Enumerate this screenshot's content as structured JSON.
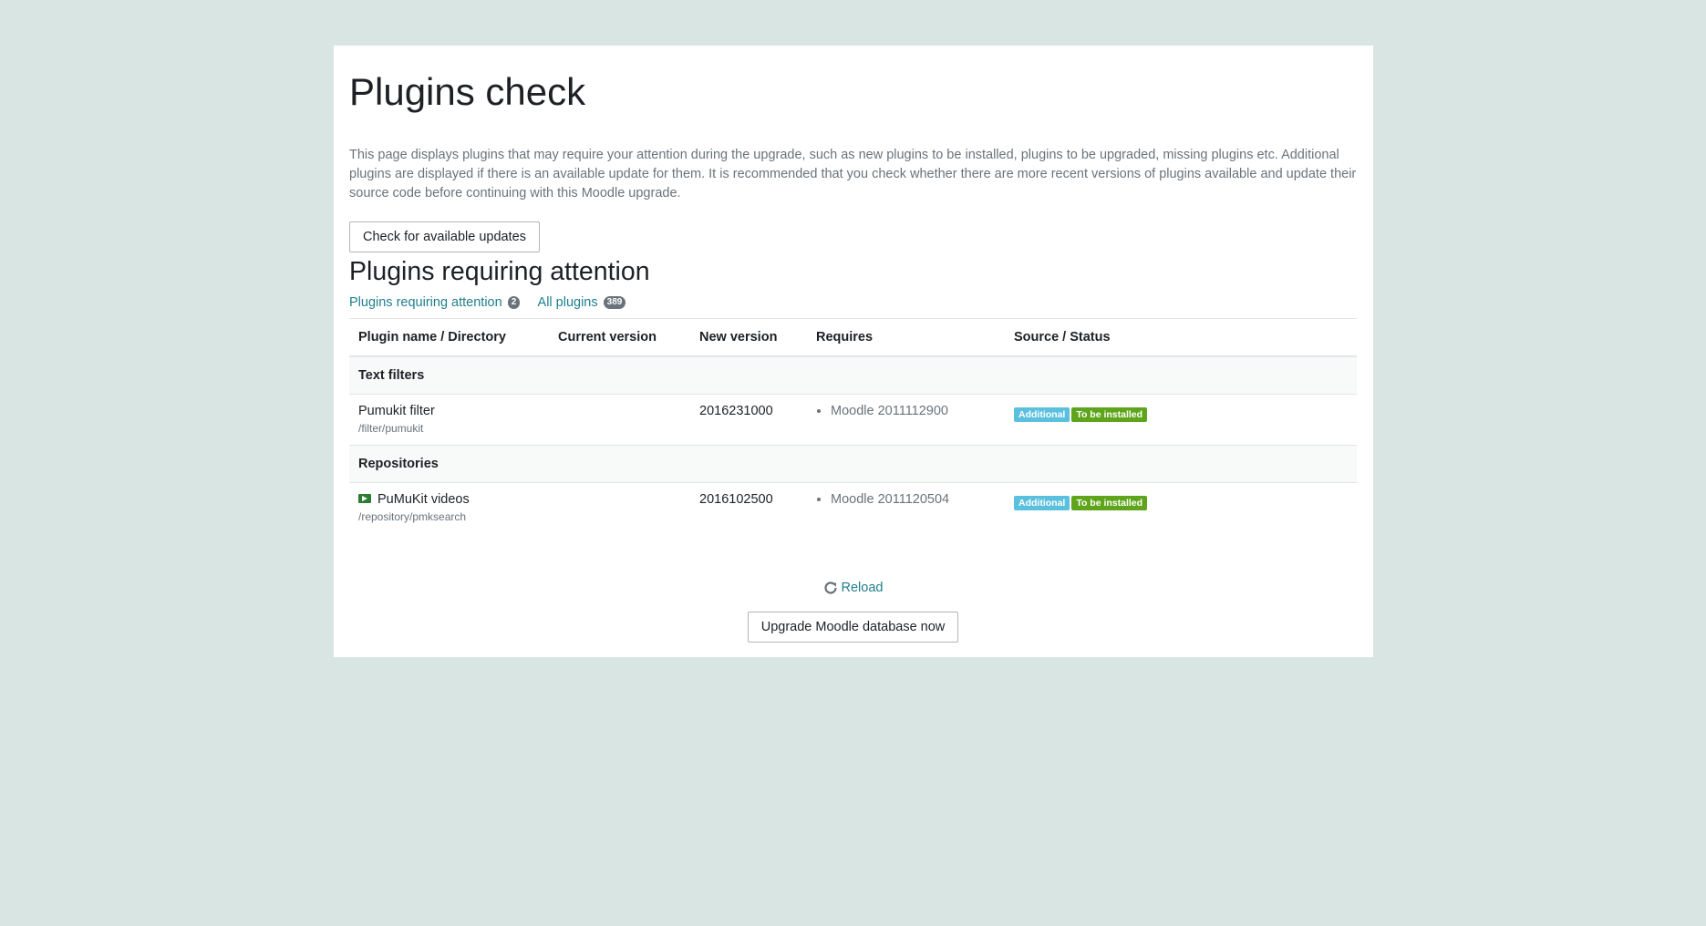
{
  "page": {
    "title": "Plugins check",
    "intro": "This page displays plugins that may require your attention during the upgrade, such as new plugins to be installed, plugins to be upgraded, missing plugins etc. Additional plugins are displayed if there is an available update for them. It is recommended that you check whether there are more recent versions of plugins available and update their source code before continuing with this Moodle upgrade.",
    "check_updates_label": "Check for available updates",
    "section_title": "Plugins requiring attention",
    "filters": [
      {
        "label": "Plugins requiring attention",
        "count": "2"
      },
      {
        "label": "All plugins",
        "count": "389"
      }
    ]
  },
  "table": {
    "headers": [
      "Plugin name / Directory",
      "Current version",
      "New version",
      "Requires",
      "Source / Status"
    ],
    "groups": [
      {
        "name": "Text filters",
        "plugins": [
          {
            "name": "Pumukit filter",
            "dir": "/filter/pumukit",
            "current": "",
            "new": "2016231000",
            "requires": "Moodle 2011112900",
            "source": "Additional",
            "status": "To be installed"
          }
        ]
      },
      {
        "name": "Repositories",
        "plugins": [
          {
            "name": "PuMuKit videos",
            "dir": "/repository/pmksearch",
            "current": "",
            "new": "2016102500",
            "requires": "Moodle 2011120504",
            "source": "Additional",
            "status": "To be installed",
            "icon": "video-repository-icon"
          }
        ]
      }
    ]
  },
  "actions": {
    "reload_label": "Reload",
    "upgrade_label": "Upgrade Moodle database now"
  },
  "colors": {
    "background": "#d9e5e3",
    "link": "#1f7f8c",
    "label_info": "#5bc0de",
    "label_success": "#5ea51b"
  }
}
